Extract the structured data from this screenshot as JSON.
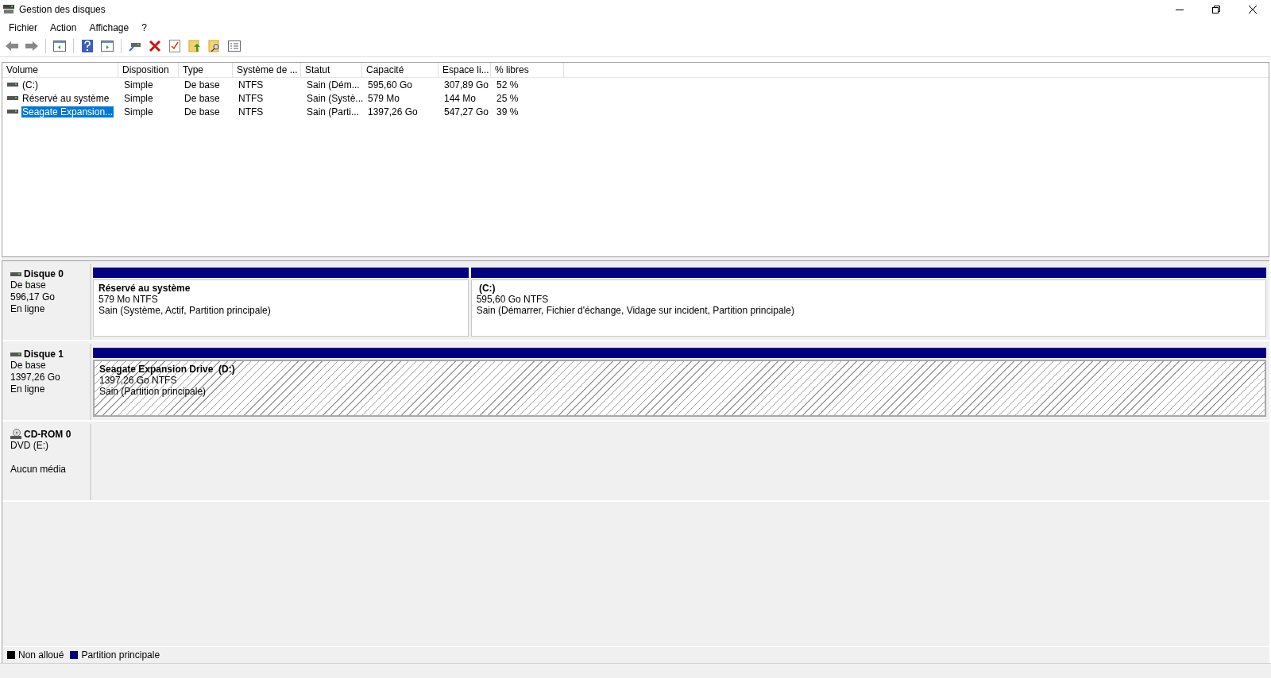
{
  "window": {
    "title": "Gestion des disques"
  },
  "menu": [
    "Fichier",
    "Action",
    "Affichage",
    "?"
  ],
  "toolbar": [
    {
      "kind": "back",
      "disabled": false
    },
    {
      "kind": "forward",
      "disabled": false
    },
    {
      "kind": "sep"
    },
    {
      "kind": "tree"
    },
    {
      "kind": "sep"
    },
    {
      "kind": "help"
    },
    {
      "kind": "pane"
    },
    {
      "kind": "sep"
    },
    {
      "kind": "connect"
    },
    {
      "kind": "delete"
    },
    {
      "kind": "check"
    },
    {
      "kind": "folder-up"
    },
    {
      "kind": "folder-search"
    },
    {
      "kind": "list"
    }
  ],
  "table": {
    "columns": [
      "Volume",
      "Disposition",
      "Type",
      "Système de ...",
      "Statut",
      "Capacité",
      "Espace li...",
      "% libres"
    ],
    "rows": [
      {
        "cells": [
          "(C:)",
          "Simple",
          "De base",
          "NTFS",
          "Sain (Dém...",
          "595,60 Go",
          "307,89 Go",
          "52 %"
        ],
        "selected": false
      },
      {
        "cells": [
          "Réservé au système",
          "Simple",
          "De base",
          "NTFS",
          "Sain (Systè...",
          "579 Mo",
          "144 Mo",
          "25 %"
        ],
        "selected": false
      },
      {
        "cells": [
          "Seagate Expansion...",
          "Simple",
          "De base",
          "NTFS",
          "Sain (Parti...",
          "1397,26 Go",
          "547,27 Go",
          "39 %"
        ],
        "selected": true
      }
    ]
  },
  "disks": [
    {
      "kind": "disk",
      "name": "Disque 0",
      "lines": [
        "De base",
        "596,17 Go",
        "En ligne"
      ],
      "partitions": [
        {
          "title": "Réservé au système",
          "size": "579 Mo NTFS",
          "status": "Sain (Système, Actif, Partition principale)",
          "selected": false
        },
        {
          "title": " (C:)",
          "size": "595,60 Go NTFS",
          "status": "Sain (Démarrer, Fichier d'échange, Vidage sur incident, Partition principale)",
          "selected": false
        }
      ]
    },
    {
      "kind": "disk",
      "name": "Disque 1",
      "lines": [
        "De base",
        "1397,26 Go",
        "En ligne"
      ],
      "partitions": [
        {
          "title": "Seagate Expansion Drive  (D:)",
          "size": "1397,26 Go NTFS",
          "status": "Sain (Partition principale)",
          "selected": true
        }
      ]
    },
    {
      "kind": "cdrom",
      "name": "CD-ROM 0",
      "lines": [
        "DVD (E:)",
        "Aucun média"
      ]
    }
  ],
  "legend": [
    {
      "label": "Non alloué",
      "color": "#000000"
    },
    {
      "label": "Partition principale",
      "color": "#000080"
    }
  ]
}
